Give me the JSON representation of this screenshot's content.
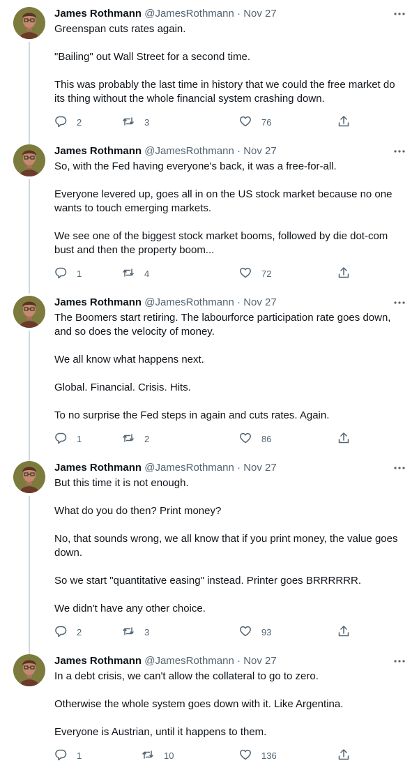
{
  "tweets": [
    {
      "author": "James Rothmann",
      "handle": "@JamesRothmann",
      "separator": "·",
      "date": "Nov 27",
      "paragraphs": [
        "Greenspan cuts rates again.",
        "\"Bailing\" out Wall Street for a second time.",
        "This was probably the last time in history that we could the free market do its thing without the whole financial system crashing down."
      ],
      "replies": "2",
      "retweets": "3",
      "likes": "76"
    },
    {
      "author": "James Rothmann",
      "handle": "@JamesRothmann",
      "separator": "·",
      "date": "Nov 27",
      "paragraphs": [
        "So, with the Fed having everyone's back, it was a free-for-all.",
        "Everyone levered up, goes all in on the US stock market because no one wants to touch emerging markets.",
        "We see one of the biggest stock market booms, followed by die dot-com bust and then the property boom..."
      ],
      "replies": "1",
      "retweets": "4",
      "likes": "72"
    },
    {
      "author": "James Rothmann",
      "handle": "@JamesRothmann",
      "separator": "·",
      "date": "Nov 27",
      "paragraphs": [
        "The Boomers start retiring. The labourforce participation rate goes down, and so does the velocity of money.",
        "We all know what happens next.",
        "Global. Financial. Crisis. Hits.",
        "To no surprise the Fed steps in again and cuts rates. Again."
      ],
      "replies": "1",
      "retweets": "2",
      "likes": "86"
    },
    {
      "author": "James Rothmann",
      "handle": "@JamesRothmann",
      "separator": "·",
      "date": "Nov 27",
      "paragraphs": [
        "But this time it is not enough.",
        "What do you do then? Print money?",
        "No, that sounds wrong, we all know that if you print money, the value goes down.",
        "So we start \"quantitative easing\" instead. Printer goes BRRRRRR.",
        "We didn't have any other choice."
      ],
      "replies": "2",
      "retweets": "3",
      "likes": "93"
    },
    {
      "author": "James Rothmann",
      "handle": "@JamesRothmann",
      "separator": "·",
      "date": "Nov 27",
      "paragraphs": [
        "In a debt crisis, we can't allow the collateral to go to zero.",
        "Otherwise the whole system goes down with it. Like Argentina.",
        "Everyone is Austrian, until it happens to them."
      ],
      "replies": "1",
      "retweets": "10",
      "likes": "136"
    }
  ],
  "icons": {
    "reply": "reply-icon",
    "retweet": "retweet-icon",
    "like": "heart-icon",
    "share": "share-icon",
    "more": "more-icon"
  },
  "colors": {
    "text": "#0f1419",
    "secondary": "#536471",
    "thread_line": "#cfd9de"
  }
}
